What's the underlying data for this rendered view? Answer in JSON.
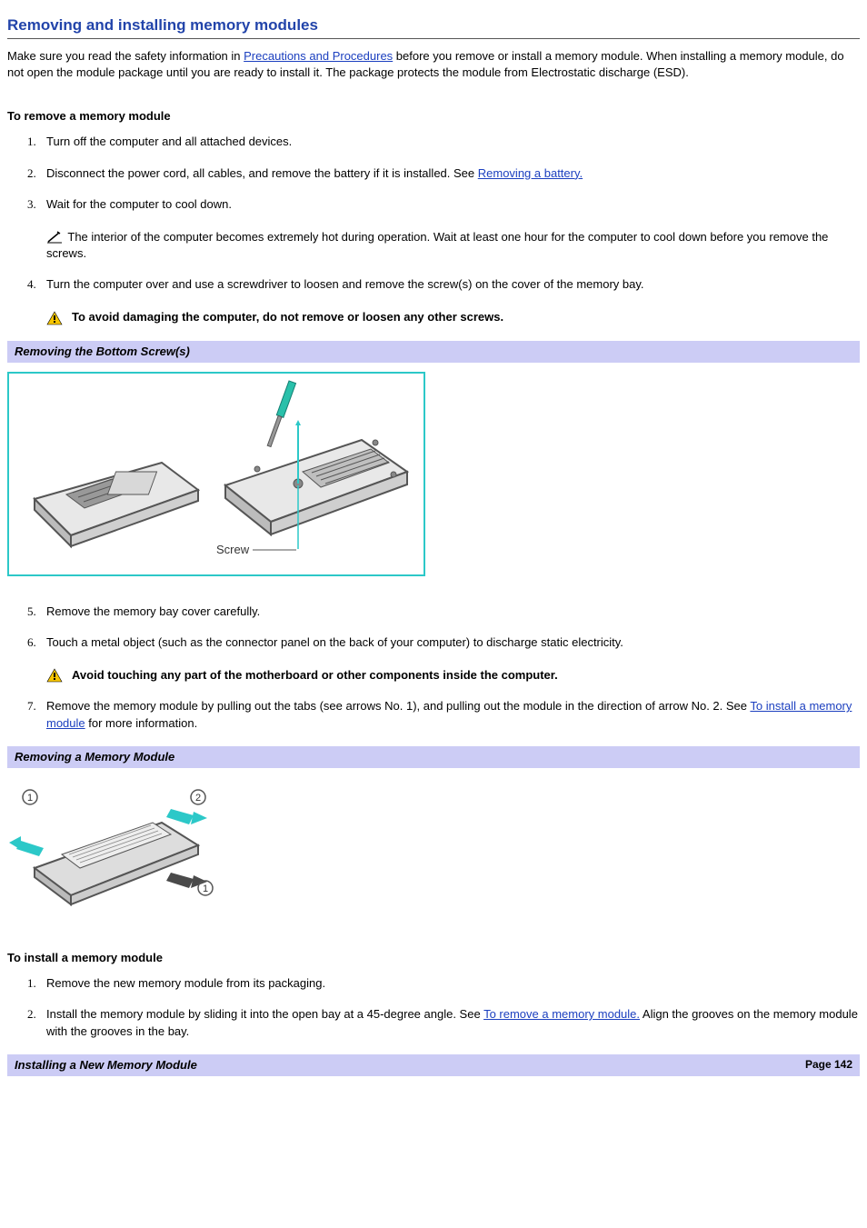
{
  "title": "Removing and installing memory modules",
  "intro": {
    "prefix": "Make sure you read the safety information in ",
    "link1": "Precautions and Procedures",
    "suffix": " before you remove or install a memory module. When installing a memory module, do not open the module package until you are ready to install it. The package protects the module from Electrostatic discharge (ESD)."
  },
  "remove": {
    "heading": "To remove a memory module",
    "steps": {
      "1": "Turn off the computer and all attached devices.",
      "2_prefix": "Disconnect the power cord, all cables, and remove the battery if it is installed. See ",
      "2_link": "Removing a battery.",
      "3": "Wait for the computer to cool down.",
      "3_note": " The interior of the computer becomes extremely hot during operation. Wait at least one hour for the computer to cool down before you remove the screws.",
      "4": "Turn the computer over and use a screwdriver to loosen and remove the screw(s) on the cover of the memory bay.",
      "4_warn": "To avoid damaging the computer, do not remove or loosen any other screws.",
      "5": "Remove the memory bay cover carefully.",
      "6": "Touch a metal object (such as the connector panel on the back of your computer) to discharge static electricity.",
      "6_warn": "Avoid touching any part of the motherboard or other components inside the computer.",
      "7_prefix": "Remove the memory module by pulling out the tabs (see arrows No. 1), and pulling out the module in the direction of arrow No. 2. See ",
      "7_link": "To install a memory module",
      "7_suffix": " for more information."
    }
  },
  "caption1": "Removing the Bottom Screw(s)",
  "figure1_label": "Screw",
  "caption2": "Removing a Memory Module",
  "install": {
    "heading": "To install a memory module",
    "steps": {
      "1": "Remove the new memory module from its packaging.",
      "2_prefix": "Install the memory module by sliding it into the open bay at a 45-degree angle. See ",
      "2_link": "To remove a memory module.",
      "2_suffix": " Align the grooves on the memory module with the grooves in the bay."
    }
  },
  "footer": {
    "caption": "Installing a New Memory Module",
    "page": "Page 142"
  }
}
